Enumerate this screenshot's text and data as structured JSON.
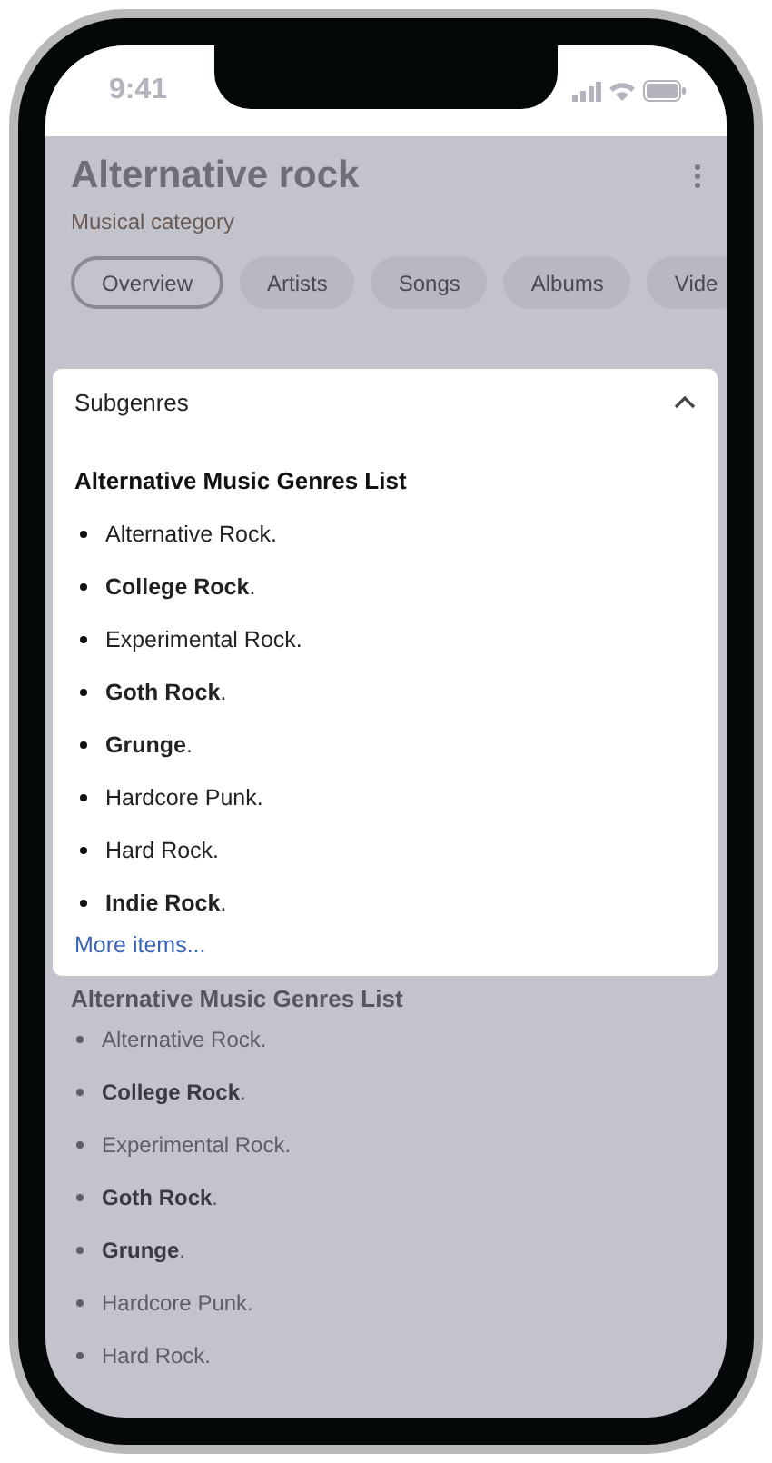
{
  "status_bar": {
    "time": "9:41"
  },
  "header": {
    "title": "Alternative rock",
    "subtitle": "Musical category"
  },
  "tabs": [
    {
      "label": "Overview",
      "selected": true
    },
    {
      "label": "Artists",
      "selected": false
    },
    {
      "label": "Songs",
      "selected": false
    },
    {
      "label": "Albums",
      "selected": false
    },
    {
      "label": "Vide",
      "selected": false
    }
  ],
  "subgenres_panel": {
    "title": "Subgenres",
    "expanded": true,
    "heading": "Alternative Music Genres List",
    "items": [
      "Alternative Rock.",
      "**College Rock**.",
      "Experimental Rock.",
      "**Goth Rock**.",
      "**Grunge**.",
      "Hardcore Punk.",
      "Hard Rock.",
      "**Indie Rock**."
    ],
    "more_link": "More items..."
  },
  "background_list": {
    "heading": "Alternative Music Genres List",
    "items": [
      "Alternative Rock.",
      "**College Rock**.",
      "Experimental Rock.",
      "**Goth Rock**.",
      "**Grunge**.",
      "Hardcore Punk.",
      "Hard Rock."
    ]
  }
}
